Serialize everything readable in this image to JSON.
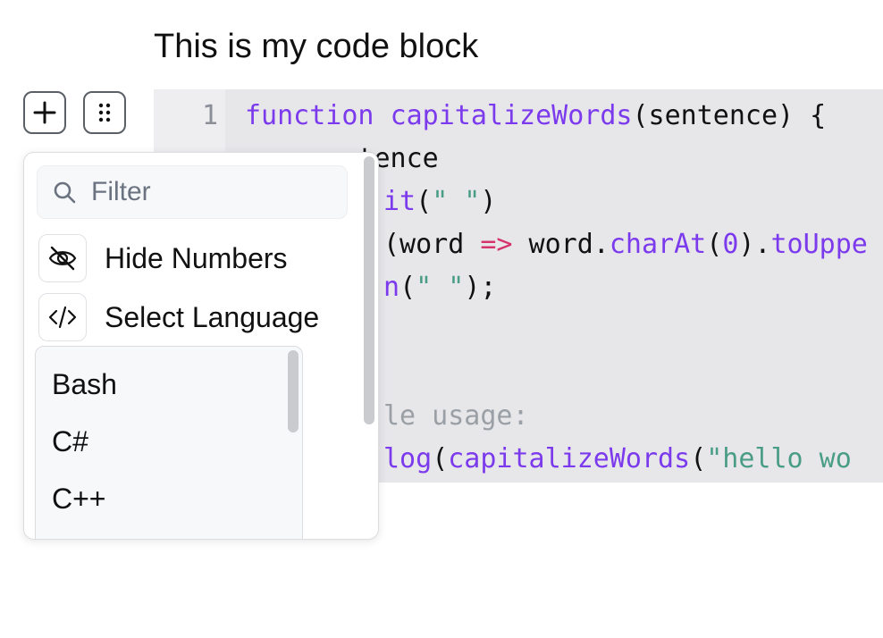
{
  "page": {
    "heading": "This is my code block"
  },
  "toolbar": {
    "add_label": "+",
    "drag_label": "drag"
  },
  "code": {
    "line_numbers": [
      "1"
    ],
    "lines": [
      [
        {
          "t": "function ",
          "c": "kw"
        },
        {
          "t": "capitalizeWords",
          "c": "fn"
        },
        {
          "t": "(sentence) {",
          "c": "txt"
        }
      ],
      [
        {
          "t": "    sentence",
          "c": "txt"
        }
      ],
      [
        {
          "t": "it",
          "c": "fn"
        },
        {
          "t": "(",
          "c": "txt"
        },
        {
          "t": "\" \"",
          "c": "str"
        },
        {
          "t": ")",
          "c": "txt"
        }
      ],
      [
        {
          "t": "(word ",
          "c": "txt"
        },
        {
          "t": "=>",
          "c": "op"
        },
        {
          "t": " word.",
          "c": "txt"
        },
        {
          "t": "charAt",
          "c": "fn"
        },
        {
          "t": "(",
          "c": "txt"
        },
        {
          "t": "0",
          "c": "num"
        },
        {
          "t": ").",
          "c": "txt"
        },
        {
          "t": "toUppe",
          "c": "fn"
        }
      ],
      [
        {
          "t": "n",
          "c": "fn"
        },
        {
          "t": "(",
          "c": "txt"
        },
        {
          "t": "\" \"",
          "c": "str"
        },
        {
          "t": ");",
          "c": "txt"
        }
      ],
      [
        {
          "t": "",
          "c": "txt"
        }
      ],
      [
        {
          "t": "",
          "c": "txt"
        }
      ],
      [
        {
          "t": "le usage:",
          "c": "cm"
        }
      ],
      [
        {
          "t": "log",
          "c": "fn"
        },
        {
          "t": "(",
          "c": "txt"
        },
        {
          "t": "capitalizeWords",
          "c": "fn"
        },
        {
          "t": "(",
          "c": "txt"
        },
        {
          "t": "\"hello wo",
          "c": "str"
        }
      ]
    ]
  },
  "menu": {
    "filter_placeholder": "Filter",
    "hide_numbers_label": "Hide Numbers",
    "select_language_label": "Select Language",
    "languages": [
      "Bash",
      "C#",
      "C++"
    ]
  },
  "colors": {
    "keyword": "#7c3aed",
    "string": "#4a9d85",
    "operator": "#d6336c",
    "comment": "#9aa0a6",
    "code_bg": "#e7e7ea"
  }
}
